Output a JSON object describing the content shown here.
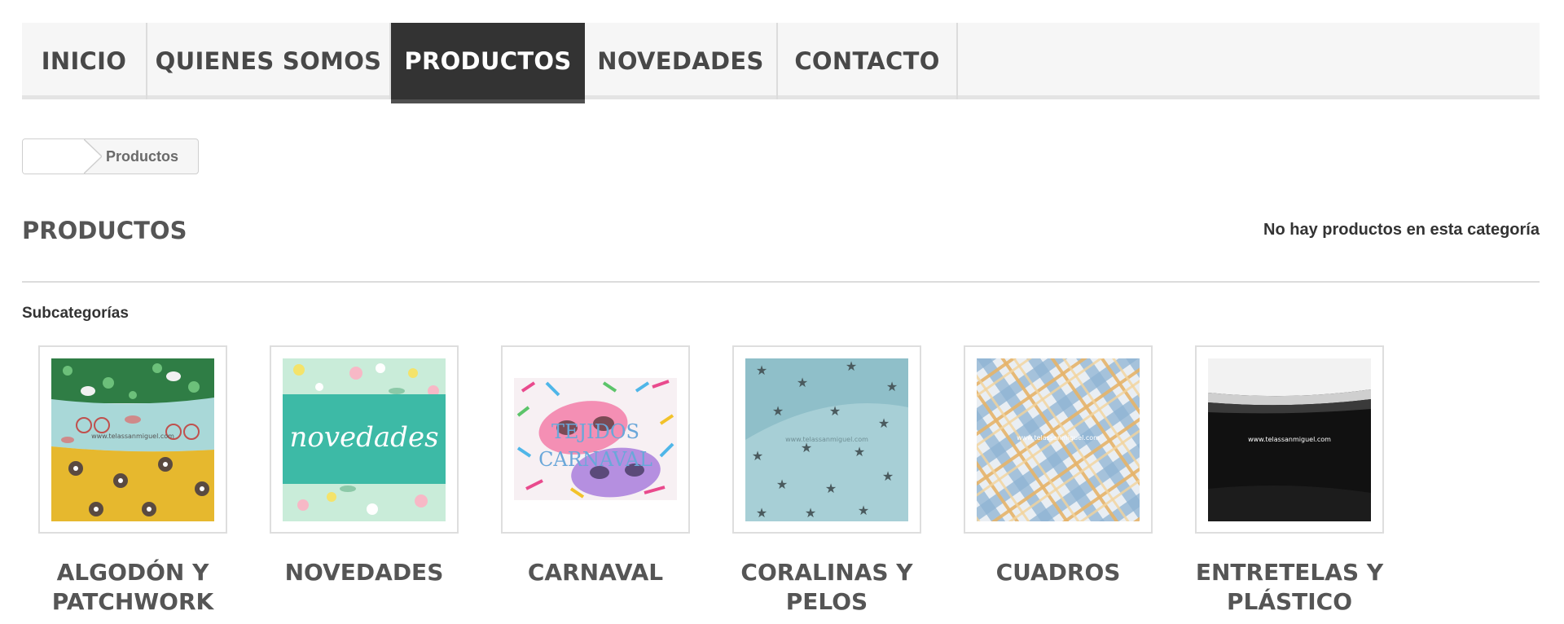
{
  "menu": {
    "items": [
      {
        "label": "INICIO"
      },
      {
        "label": "QUIENES SOMOS"
      },
      {
        "label": "PRODUCTOS"
      },
      {
        "label": "NOVEDADES"
      },
      {
        "label": "CONTACTO"
      }
    ],
    "active_index": 2
  },
  "breadcrumb": {
    "home_icon": "home-icon",
    "current": "Productos"
  },
  "category": {
    "title": "PRODUCTOS",
    "empty_message": "No hay productos en esta categoría"
  },
  "subcategories": {
    "heading": "Subcategorías",
    "items": [
      {
        "name": "ALGODÓN Y\nPATCHWORK",
        "image": "patchwork-fabric-image"
      },
      {
        "name": "NOVEDADES",
        "image": "novedades-banner-image",
        "image_text": "novedades"
      },
      {
        "name": "CARNAVAL",
        "image": "carnival-masks-image",
        "image_text_1": "TEJIDOS",
        "image_text_2": "CARNAVAL"
      },
      {
        "name": "CORALINAS Y\nPELOS",
        "image": "star-fabric-image"
      },
      {
        "name": "CUADROS",
        "image": "plaid-fabric-image"
      },
      {
        "name": "ENTRETELAS Y\nPLÁSTICO",
        "image": "interfacing-fabric-image"
      }
    ],
    "watermark": "www.telassanmiguel.com"
  },
  "colors": {
    "menu_active_bg": "#333333",
    "menu_bg": "#f6f6f6",
    "title_gray": "#555555",
    "teal": "#3dbaa6"
  }
}
